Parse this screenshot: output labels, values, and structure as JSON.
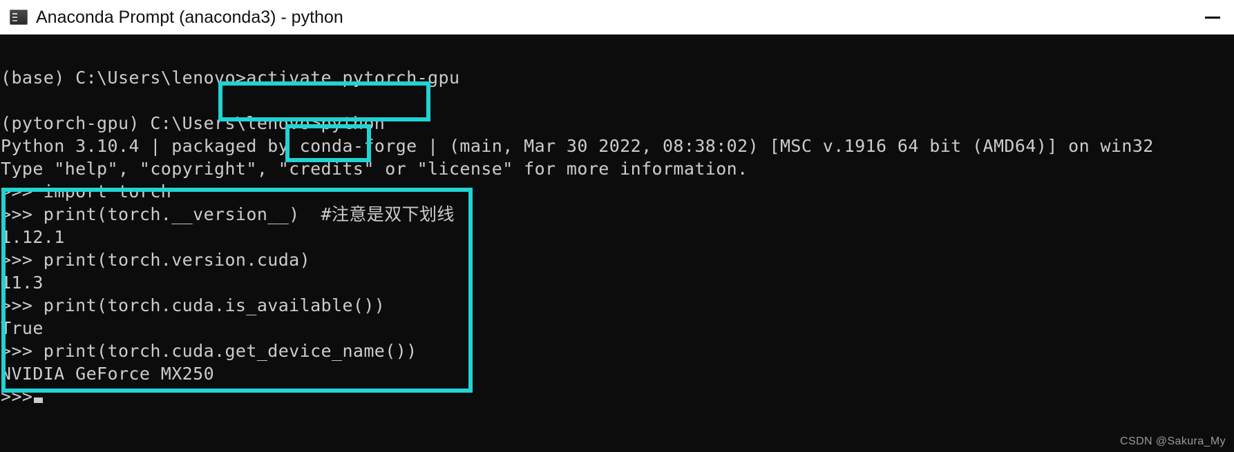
{
  "window": {
    "title": "Anaconda Prompt (anaconda3) - python",
    "icon": "console-window-icon",
    "controls": [
      {
        "name": "minimize-button",
        "glyph": "minimize-icon",
        "label": "Minimize"
      }
    ],
    "titlebar_bg": "#ffffff",
    "console_bg": "#0c0c0c",
    "console_fg": "#cccccc"
  },
  "annotations": {
    "color": "#22d3d3",
    "boxes": [
      {
        "name": "activate-command-highlight",
        "target": "activate pytorch-gpu"
      },
      {
        "name": "python-command-highlight",
        "target": "python"
      },
      {
        "name": "torch-verification-block-highlight",
        "target": "torch version checks"
      }
    ]
  },
  "console": {
    "lines": [
      "",
      "(base) C:\\Users\\lenovo>activate pytorch-gpu",
      "",
      "(pytorch-gpu) C:\\Users\\lenovo>python",
      "Python 3.10.4 | packaged by conda-forge | (main, Mar 30 2022, 08:38:02) [MSC v.1916 64 bit (AMD64)] on win32",
      "Type \"help\", \"copyright\", \"credits\" or \"license\" for more information.",
      ">>> import torch",
      ">>> print(torch.__version__)  #注意是双下划线",
      "1.12.1",
      ">>> print(torch.version.cuda)",
      "11.3",
      ">>> print(torch.cuda.is_available())",
      "True",
      ">>> print(torch.cuda.get_device_name())",
      "NVIDIA GeForce MX250",
      ">>>"
    ],
    "cursor_line_index": 15,
    "cursor": "block"
  },
  "watermark": {
    "text": "CSDN @Sakura_My"
  }
}
